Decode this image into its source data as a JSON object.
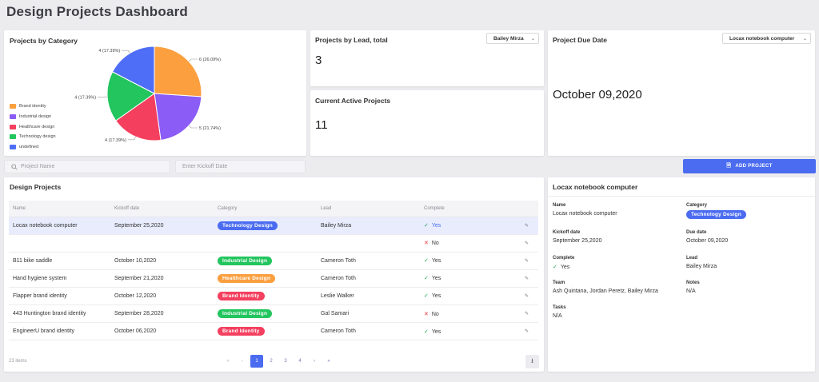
{
  "page_title": "Design Projects Dashboard",
  "pie_card": {
    "title": "Projects by Category",
    "legend": [
      {
        "label": "Brand identity",
        "color": "#fb9f3f"
      },
      {
        "label": "Industrial design",
        "color": "#8b5cf6"
      },
      {
        "label": "Healthcare design",
        "color": "#f43f5e"
      },
      {
        "label": "Technology design",
        "color": "#22c55e"
      },
      {
        "label": "undefined",
        "color": "#4f6ef7"
      }
    ],
    "slices": [
      {
        "label": "6 (26.09%)",
        "value": 6,
        "color": "#fb9f3f"
      },
      {
        "label": "5 (21.74%)",
        "value": 5,
        "color": "#8b5cf6"
      },
      {
        "label": "4 (17.39%)",
        "value": 4,
        "color": "#f43f5e"
      },
      {
        "label": "4 (17.39%)",
        "value": 4,
        "color": "#22c55e"
      },
      {
        "label": "4 (17.39%)",
        "value": 4,
        "color": "#4f6ef7"
      }
    ]
  },
  "lead_card": {
    "title": "Projects by Lead, total",
    "select_value": "Bailey Mirza",
    "value": "3"
  },
  "active_card": {
    "title": "Current Active Projects",
    "value": "11"
  },
  "due_card": {
    "title": "Project Due Date",
    "select_value": "Locax notebook computer",
    "value": "October 09,2020"
  },
  "search": {
    "name_placeholder": "Project Name",
    "date_placeholder": "Enter Kickoff Date"
  },
  "add_button": {
    "label": "ADD PROJECT",
    "color": "#4b6cf0"
  },
  "table": {
    "title": "Design Projects",
    "columns": [
      "Name",
      "Kickoff date",
      "Category",
      "Lead",
      "Complete"
    ],
    "rows": [
      {
        "name": "Locax notebook computer",
        "date": "September 25,2020",
        "category": "Technology Design",
        "cat_color": "#4b6cf0",
        "lead": "Bailey Mirza",
        "complete": "Yes",
        "ok": true,
        "selected": true
      },
      {
        "name": "",
        "date": "",
        "category": "",
        "cat_color": "",
        "lead": "",
        "complete": "No",
        "ok": false,
        "selected": false
      },
      {
        "name": "B11 bike saddle",
        "date": "October 10,2020",
        "category": "Industrial Design",
        "cat_color": "#22c55e",
        "lead": "Cameron Toth",
        "complete": "Yes",
        "ok": true,
        "selected": false
      },
      {
        "name": "Hand hygiene system",
        "date": "September 21,2020",
        "category": "Healthcare Design",
        "cat_color": "#fb9f3f",
        "lead": "Cameron Toth",
        "complete": "Yes",
        "ok": true,
        "selected": false
      },
      {
        "name": "Flapper brand identity",
        "date": "October 12,2020",
        "category": "Brand Identity",
        "cat_color": "#f43f5e",
        "lead": "Leslie Walker",
        "complete": "Yes",
        "ok": true,
        "selected": false
      },
      {
        "name": "443 Huntington brand identity",
        "date": "September 28,2020",
        "category": "Industrial Design",
        "cat_color": "#22c55e",
        "lead": "Gal Samari",
        "complete": "No",
        "ok": false,
        "selected": false
      },
      {
        "name": "EngineerU brand identity",
        "date": "October 06,2020",
        "category": "Brand Identity",
        "cat_color": "#f43f5e",
        "lead": "Cameron Toth",
        "complete": "Yes",
        "ok": true,
        "selected": false
      }
    ],
    "item_count": "23 items",
    "pages": [
      "1",
      "2",
      "3",
      "4"
    ],
    "current_page": "1"
  },
  "detail": {
    "title": "Locax notebook computer",
    "name_label": "Name",
    "name": "Locax notebook computer",
    "category_label": "Category",
    "category": "Technology Design",
    "category_color": "#4b6cf0",
    "kickoff_label": "Kickoff date",
    "kickoff": "September 25,2020",
    "due_label": "Due date",
    "due": "October 09,2020",
    "complete_label": "Complete",
    "complete": "Yes",
    "lead_label": "Lead",
    "lead": "Bailey Mirza",
    "team_label": "Team",
    "team": "Ash Quintana, Jordan Peretz, Bailey Mirza",
    "notes_label": "Notes",
    "notes": "N/A",
    "tasks_label": "Tasks",
    "tasks": "N/A"
  }
}
